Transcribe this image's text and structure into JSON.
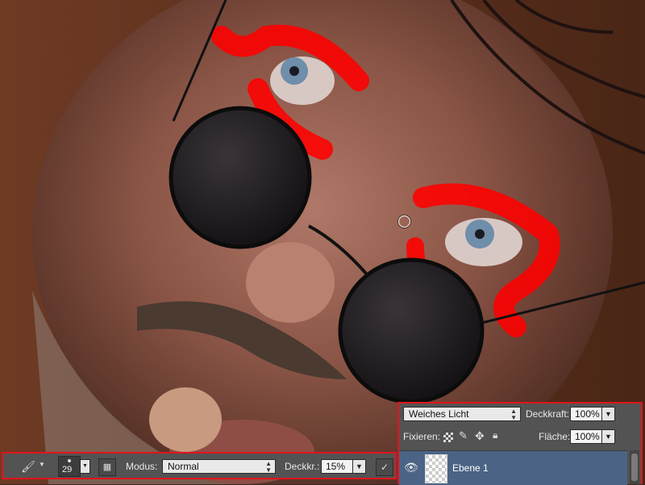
{
  "options_bar": {
    "brush_icon": "brush-icon",
    "brush_size": "29",
    "mode_label": "Modus:",
    "mode_value": "Normal",
    "opacity_label": "Deckkr.:",
    "opacity_value": "15%"
  },
  "layers_panel": {
    "blend_mode": "Weiches Licht",
    "opacity_label": "Deckkraft:",
    "opacity_value": "100%",
    "lock_label": "Fixieren:",
    "fill_label": "Fläche:",
    "fill_value": "100%",
    "layers": [
      {
        "name": "Ebene 1",
        "visible": true,
        "selected": true
      }
    ]
  },
  "colors": {
    "panel_bg": "#535353",
    "highlight_border": "#e1141b",
    "selected_row": "#4b6486",
    "paint_stroke": "#ff0000"
  }
}
